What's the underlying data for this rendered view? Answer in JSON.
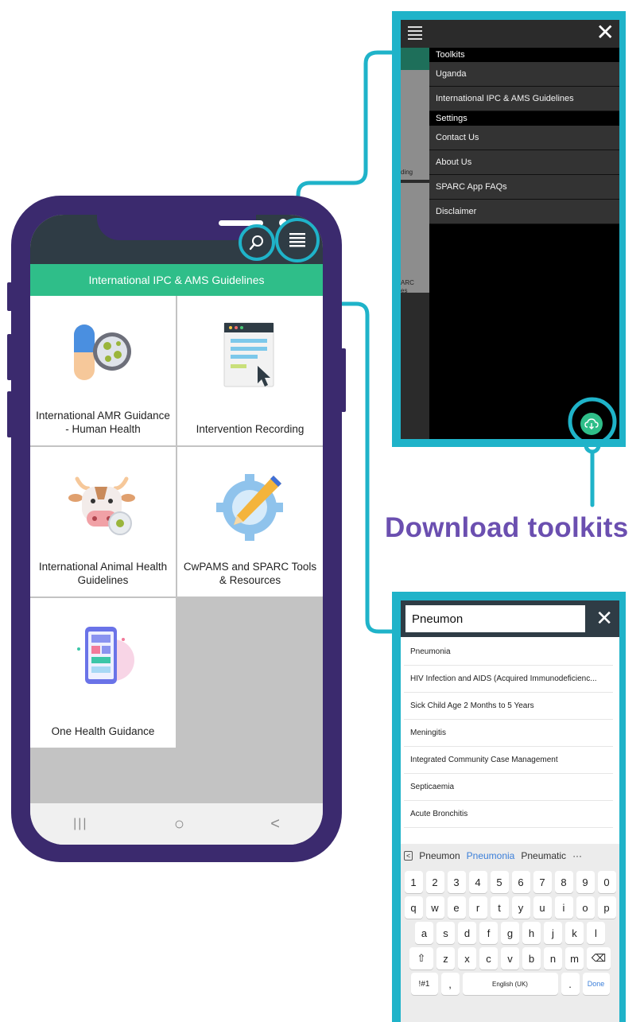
{
  "phone": {
    "title_bar": "International IPC & AMS Guidelines",
    "tiles": [
      {
        "label": "International AMR Guidance - Human Health",
        "icon": "pill-bacteria-icon"
      },
      {
        "label": "Intervention Recording",
        "icon": "document-cursor-icon"
      },
      {
        "label": "International Animal Health Guidelines",
        "icon": "cow-bacteria-icon"
      },
      {
        "label": "CwPAMS and SPARC Tools & Resources",
        "icon": "gear-pencil-icon"
      },
      {
        "label": "One Health Guidance",
        "icon": "phone-app-icon"
      }
    ],
    "navbar": {
      "recent": "|||",
      "home": "○",
      "back": "<"
    }
  },
  "menu": {
    "close": "✕",
    "sections": [
      {
        "title": "Toolkits",
        "items": [
          "Uganda",
          "International IPC & AMS Guidelines"
        ]
      },
      {
        "title": "Settings",
        "items": [
          "Contact Us",
          "About Us",
          "SPARC App FAQs",
          "Disclaimer"
        ]
      }
    ],
    "left_strip": {
      "text1": "ding",
      "text2": "ARC",
      "text3": "es"
    }
  },
  "download_label": "Download toolkits",
  "search": {
    "value": "Pneumon",
    "close": "✕",
    "suggestions": [
      "Pneumonia",
      "HIV Infection and AIDS (Acquired Immunodeficienc...",
      "Sick Child Age 2 Months to 5 Years",
      "Meningitis",
      "Integrated Community Case Management",
      "Septicaemia",
      "Acute Bronchitis"
    ],
    "keyboard": {
      "suggestions": [
        "Pneumon",
        "Pneumonia",
        "Pneumatic",
        "···"
      ],
      "row_numbers": [
        "1",
        "2",
        "3",
        "4",
        "5",
        "6",
        "7",
        "8",
        "9",
        "0"
      ],
      "row1": [
        "q",
        "w",
        "e",
        "r",
        "t",
        "y",
        "u",
        "i",
        "o",
        "p"
      ],
      "row2": [
        "a",
        "s",
        "d",
        "f",
        "g",
        "h",
        "j",
        "k",
        "l"
      ],
      "row3": [
        "z",
        "x",
        "c",
        "v",
        "b",
        "n",
        "m"
      ],
      "symbols": "!#1",
      "comma": ",",
      "space": "English (UK)",
      "period": ".",
      "done": "Done"
    }
  },
  "colors": {
    "accent": "#1fb3c9",
    "green": "#2fbe89",
    "phone": "#3b2a6e",
    "label": "#6b4fb0"
  }
}
